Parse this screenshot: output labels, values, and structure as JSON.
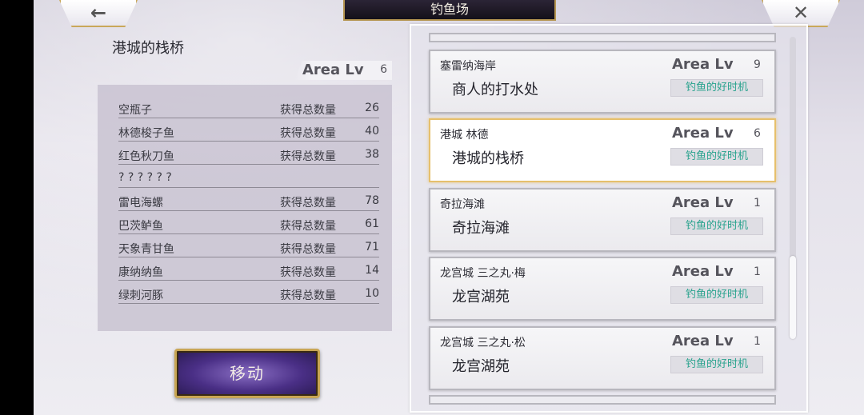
{
  "header": {
    "title": "钓鱼场",
    "back_icon": "←",
    "close_icon": "✕"
  },
  "detail": {
    "location_title": "港城的栈桥",
    "area_lv_label": "Area Lv",
    "area_lv_value": "6",
    "fish": [
      {
        "name": "空瓶子",
        "label": "获得总数量",
        "count": "26"
      },
      {
        "name": "林德梭子鱼",
        "label": "获得总数量",
        "count": "40"
      },
      {
        "name": "红色秋刀鱼",
        "label": "获得总数量",
        "count": "38"
      },
      {
        "name": "? ? ? ? ? ?",
        "label": "",
        "count": ""
      },
      {
        "name": "雷电海螺",
        "label": "获得总数量",
        "count": "78"
      },
      {
        "name": "巴茨鲈鱼",
        "label": "获得总数量",
        "count": "61"
      },
      {
        "name": "天象青甘鱼",
        "label": "获得总数量",
        "count": "71"
      },
      {
        "name": "康纳纳鱼",
        "label": "获得总数量",
        "count": "14"
      },
      {
        "name": "绿刺河豚",
        "label": "获得总数量",
        "count": "10"
      }
    ],
    "move_button": "移动"
  },
  "spots": [
    {
      "region": "塞雷纳海岸",
      "place": "商人的打水处",
      "area_lv_label": "Area Lv",
      "area_lv": "9",
      "badge": "钓鱼的好时机",
      "selected": false
    },
    {
      "region": "港城 林德",
      "place": "港城的栈桥",
      "area_lv_label": "Area Lv",
      "area_lv": "6",
      "badge": "钓鱼的好时机",
      "selected": true
    },
    {
      "region": "奇拉海滩",
      "place": "奇拉海滩",
      "area_lv_label": "Area Lv",
      "area_lv": "1",
      "badge": "钓鱼的好时机",
      "selected": false
    },
    {
      "region": "龙宫城 三之丸·梅",
      "place": "龙宫湖苑",
      "area_lv_label": "Area Lv",
      "area_lv": "1",
      "badge": "钓鱼的好时机",
      "selected": false
    },
    {
      "region": "龙宫城 三之丸·松",
      "place": "龙宫湖苑",
      "area_lv_label": "Area Lv",
      "area_lv": "1",
      "badge": "钓鱼的好时机",
      "selected": false
    }
  ],
  "colors": {
    "accent_gold": "#c9a85a",
    "badge_text": "#2aa38e",
    "title_bar": "#1c1724"
  }
}
